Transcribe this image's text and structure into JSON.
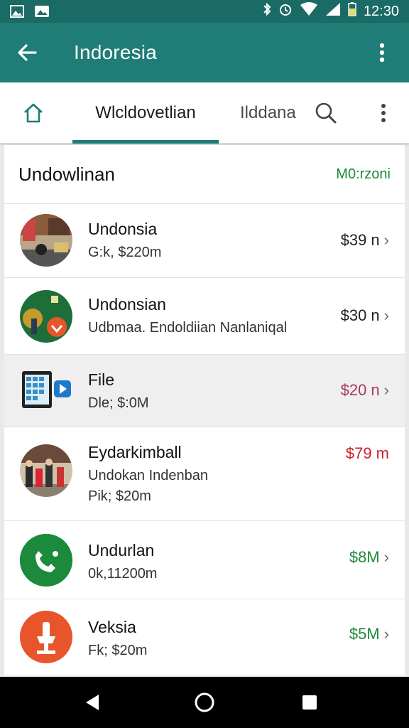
{
  "status_bar": {
    "time": "12:30"
  },
  "app_bar": {
    "title": "Indoresia"
  },
  "tabs": {
    "active_label": "Wlcldovetlian",
    "other_label": "Ilddana"
  },
  "section": {
    "title": "Undowlinan",
    "action": "M0:rzoni"
  },
  "rows": [
    {
      "title": "Undonsia",
      "subtitle": "G:k, $220m",
      "subtitle2": "",
      "amount": "$39 n",
      "amount_color": "#222222",
      "chevron": true
    },
    {
      "title": "Undonsian",
      "subtitle": "Udbmaa. Endoldiian Nanlaniqal",
      "subtitle2": "",
      "amount": "$30 n",
      "amount_color": "#222222",
      "chevron": true
    },
    {
      "title": "File",
      "subtitle": "Dle; $:0M",
      "subtitle2": "",
      "amount": "$20 n",
      "amount_color": "#a83a5a",
      "chevron": true
    },
    {
      "title": "Eydarkimball",
      "subtitle": "Undokan Indenban",
      "subtitle2": "Pik; $20m",
      "amount": "$79 m",
      "amount_color": "#cc1f2a",
      "chevron": false
    },
    {
      "title": "Undurlan",
      "subtitle": "0k,11200m",
      "subtitle2": "",
      "amount": "$8M",
      "amount_color": "#1b8a3a",
      "chevron": true
    },
    {
      "title": "Veksia",
      "subtitle": "Fk; $20m",
      "subtitle2": "",
      "amount": "$5M",
      "amount_color": "#1b8a3a",
      "chevron": true
    }
  ],
  "colors": {
    "primary": "#1f7c76",
    "primary_dark": "#1a6a66",
    "green": "#1b8a3a",
    "red": "#cc1f2a",
    "orange": "#e8552a"
  }
}
